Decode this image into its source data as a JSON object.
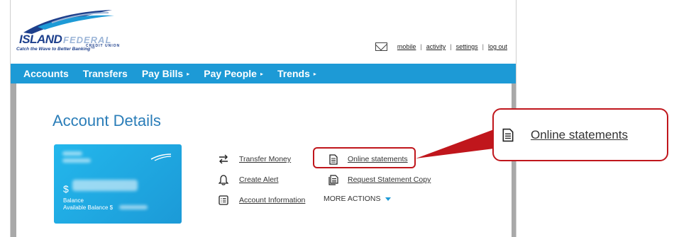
{
  "header": {
    "logo_island": "ISLAND",
    "logo_federal": "FEDERAL",
    "logo_cu": "CREDIT UNION",
    "tagline": "Catch the Wave to Better Banking™",
    "util_links": [
      "mobile",
      "activity",
      "settings",
      "log out"
    ]
  },
  "nav": {
    "items": [
      {
        "label": "Accounts",
        "caret": ""
      },
      {
        "label": "Transfers",
        "caret": ""
      },
      {
        "label": "Pay Bills",
        "caret": "▸"
      },
      {
        "label": "Pay People",
        "caret": "▸"
      },
      {
        "label": "Trends",
        "caret": "▸"
      }
    ]
  },
  "page": {
    "title": "Account Details"
  },
  "card": {
    "dollar": "$",
    "balance_label": "Balance",
    "available_label": "Available Balance $"
  },
  "actions": {
    "transfer_money": "Transfer Money",
    "create_alert": "Create Alert",
    "account_information": "Account Information",
    "online_statements": "Online statements",
    "request_statement_copy": "Request Statement Copy",
    "more_actions": "MORE ACTIONS"
  },
  "callout": {
    "label": "Online statements"
  },
  "colors": {
    "nav_blue": "#1d9ad6",
    "brand_navy": "#1d3f8c",
    "title_blue": "#2a7db8",
    "highlight_red": "#c0161c"
  },
  "icons": [
    "mail-icon",
    "transfer-icon",
    "bell-icon",
    "list-icon",
    "document-icon",
    "documents-icon",
    "triangle-down-icon"
  ]
}
